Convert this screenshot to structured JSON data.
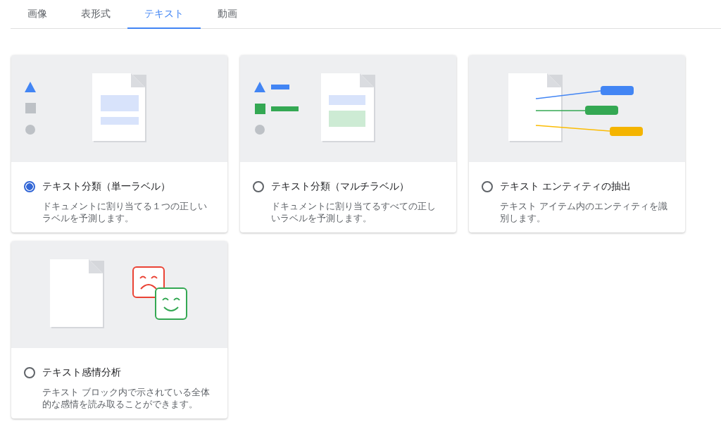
{
  "tabs": [
    {
      "label": "画像",
      "selected": false
    },
    {
      "label": "表形式",
      "selected": false
    },
    {
      "label": "テキスト",
      "selected": true
    },
    {
      "label": "動画",
      "selected": false
    }
  ],
  "cards": [
    {
      "kind": "single_label",
      "title": "テキスト分類（単一ラベル）",
      "description": "ドキュメントに割り当てる１つの正しいラベルを予測します。",
      "selected": true
    },
    {
      "kind": "multi_label",
      "title": "テキスト分類（マルチラベル）",
      "description": "ドキュメントに割り当てるすべての正しいラベルを予測します。",
      "selected": false
    },
    {
      "kind": "entity",
      "title": "テキスト エンティティの抽出",
      "description": "テキスト アイテム内のエンティティを識別します。",
      "selected": false
    },
    {
      "kind": "sentiment",
      "title": "テキスト感情分析",
      "description": "テキスト ブロック内で示されている全体的な感情を読み取ることができます。",
      "selected": false
    }
  ]
}
